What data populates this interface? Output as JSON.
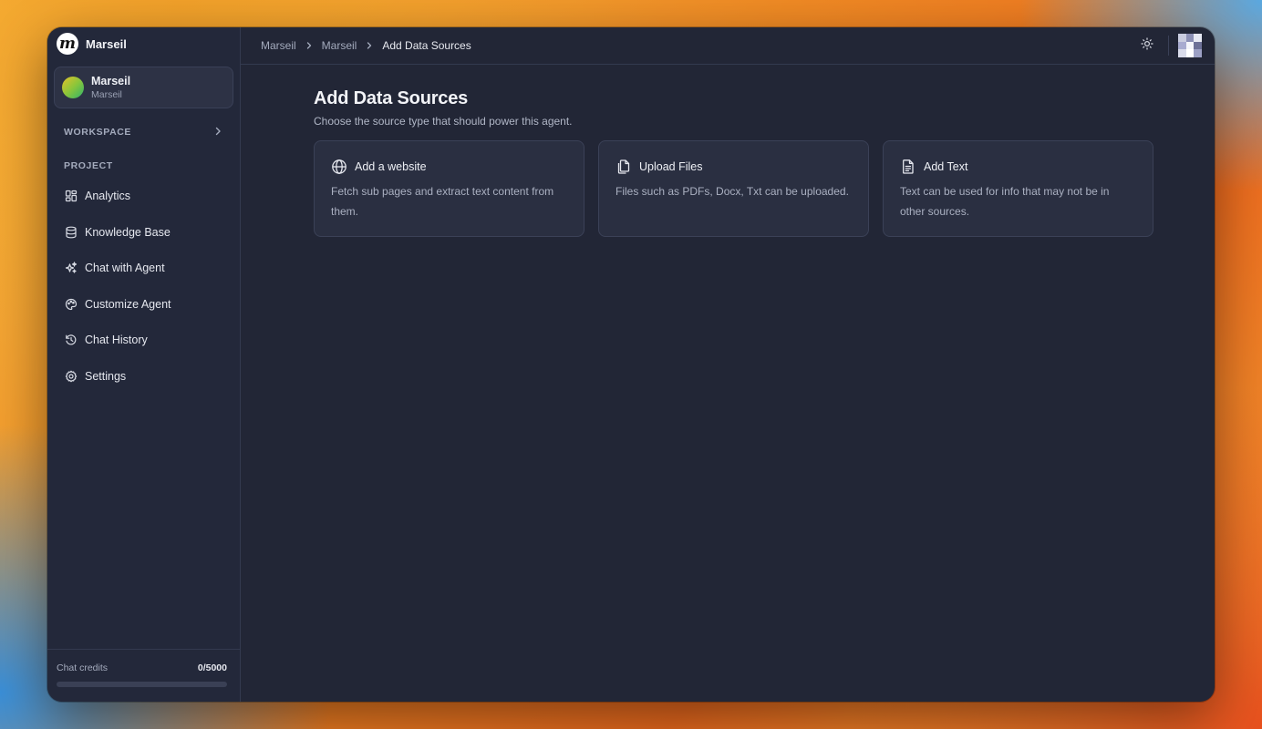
{
  "brand": {
    "name": "Marseil",
    "logo_letter": "m"
  },
  "project": {
    "title": "Marseil",
    "subtitle": "Marseil"
  },
  "sidebar": {
    "workspace_label": "WORKSPACE",
    "project_label": "PROJECT",
    "items": [
      {
        "label": "Analytics",
        "icon": "grid-icon"
      },
      {
        "label": "Knowledge Base",
        "icon": "database-icon"
      },
      {
        "label": "Chat with Agent",
        "icon": "sparkles-icon"
      },
      {
        "label": "Customize Agent",
        "icon": "palette-icon"
      },
      {
        "label": "Chat History",
        "icon": "history-icon"
      },
      {
        "label": "Settings",
        "icon": "gear-icon"
      }
    ]
  },
  "credits": {
    "label": "Chat credits",
    "value": "0/5000",
    "used_fraction": 0
  },
  "breadcrumb": {
    "items": [
      "Marseil",
      "Marseil",
      "Add Data Sources"
    ]
  },
  "page": {
    "title": "Add Data Sources",
    "subtitle": "Choose the source type that should power this agent."
  },
  "cards": [
    {
      "title": "Add a website",
      "description": "Fetch sub pages and extract text content from them.",
      "icon": "globe-icon"
    },
    {
      "title": "Upload Files",
      "description": "Files such as PDFs, Docx, Txt can be uploaded.",
      "icon": "files-icon"
    },
    {
      "title": "Add Text",
      "description": "Text can be used for info that may not be in other sources.",
      "icon": "document-text-icon"
    }
  ],
  "colors": {
    "window_bg": "#222636",
    "sidebar_bg": "#23283a",
    "card_bg": "#2a2f41",
    "text_primary": "#eef0f5",
    "text_muted": "#aab0c1"
  }
}
